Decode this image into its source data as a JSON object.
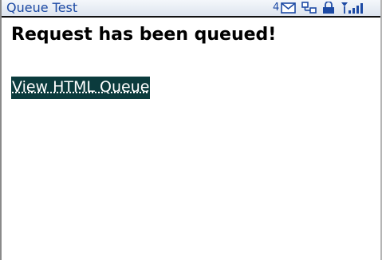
{
  "app": {
    "title": "Queue Test"
  },
  "status_bar": {
    "message_count": "4",
    "icons": [
      "mail-icon",
      "network-icon",
      "lock-icon",
      "signal-icon"
    ]
  },
  "main": {
    "message": "Request has been queued!",
    "link_label": "View HTML Queue"
  },
  "colors": {
    "title_text": "#1d4aa4",
    "link_background": "#0b3b3d",
    "link_text": "#ffffff",
    "body_text": "#000000"
  }
}
